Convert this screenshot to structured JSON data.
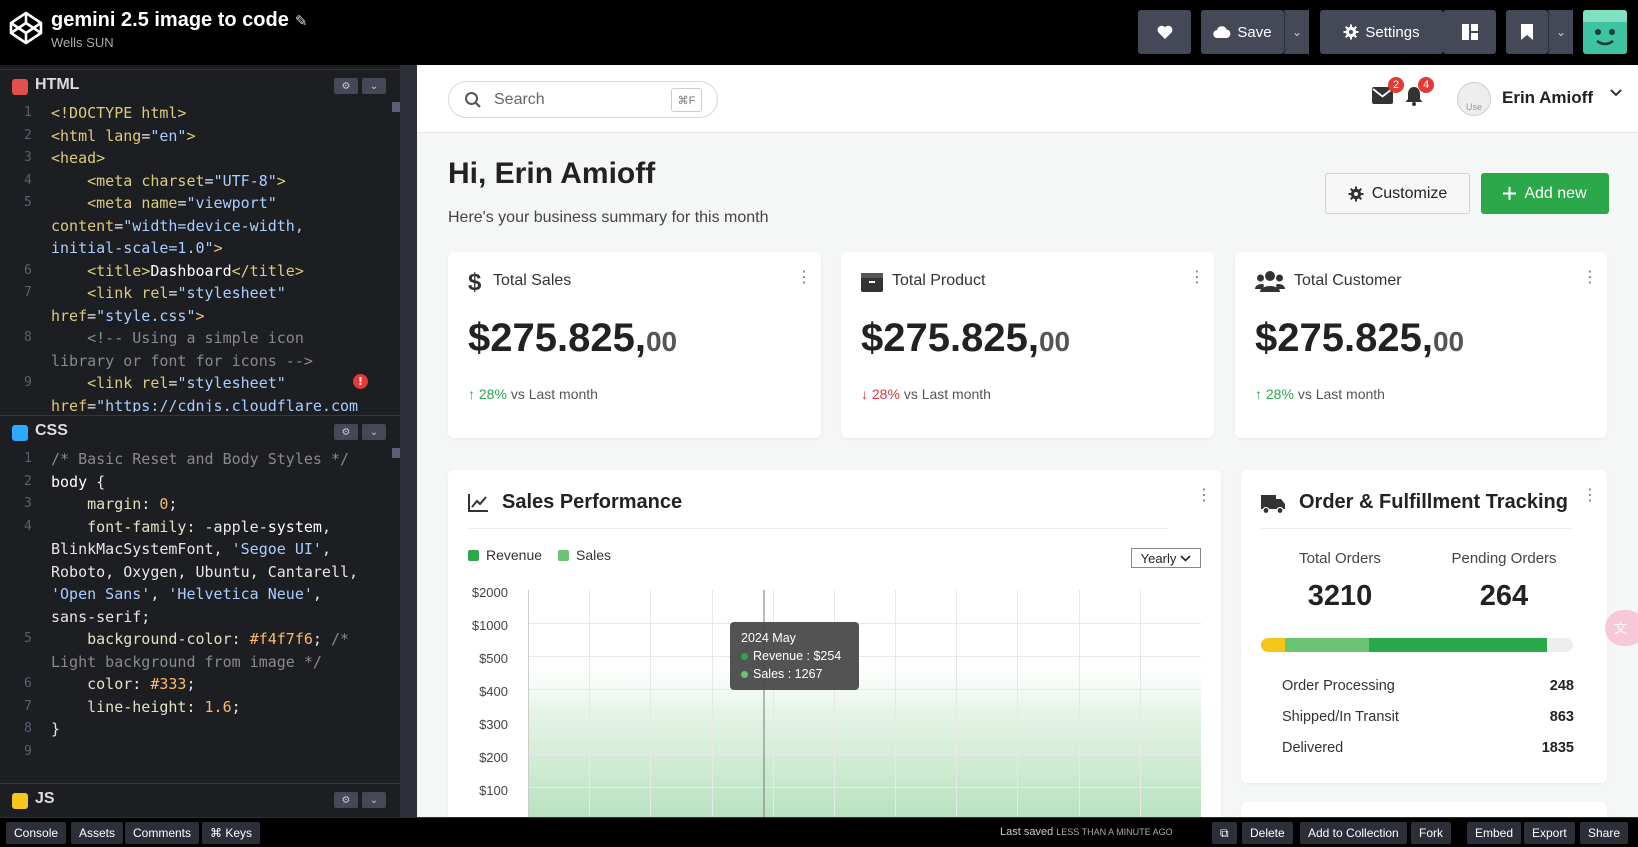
{
  "topbar": {
    "title": "gemini 2.5 image to code",
    "author": "Wells SUN",
    "save_label": "Save",
    "settings_label": "Settings"
  },
  "editors": {
    "html": {
      "label": "HTML",
      "gutter": [
        "1",
        "2",
        "3",
        "4",
        "5",
        "",
        "",
        "6",
        "7",
        "",
        "8",
        "",
        "9",
        ""
      ]
    },
    "css": {
      "label": "CSS",
      "gutter": [
        "1",
        "2",
        "3",
        "4",
        "",
        "",
        "",
        "",
        "5",
        "",
        "6",
        "7",
        "8",
        "9"
      ]
    },
    "js": {
      "label": "JS"
    }
  },
  "preview": {
    "search": {
      "placeholder": "Search",
      "shortcut": "⌘F"
    },
    "mail_count": "2",
    "bell_count": "4",
    "avatar_alt": "Use",
    "user_name": "Erin Amioff",
    "greeting": "Hi, Erin Amioff",
    "subtitle": "Here's your business summary for this month",
    "customize_label": "Customize",
    "add_new_label": "Add new",
    "stats": [
      {
        "title": "Total Sales",
        "value": "$275.825,",
        "cents": "00",
        "trend_pct": "28%",
        "trend_dir": "up",
        "trend_label": "vs Last month"
      },
      {
        "title": "Total Product",
        "value": "$275.825,",
        "cents": "00",
        "trend_pct": "28%",
        "trend_dir": "down",
        "trend_label": "vs Last month"
      },
      {
        "title": "Total Customer",
        "value": "$275.825,",
        "cents": "00",
        "trend_pct": "28%",
        "trend_dir": "up",
        "trend_label": "vs Last month"
      }
    ],
    "performance": {
      "title": "Sales Performance",
      "legend": [
        "Revenue",
        "Sales"
      ],
      "period": "Yearly",
      "y_ticks": [
        "$2000",
        "$1000",
        "$500",
        "$400",
        "$300",
        "$200",
        "$100"
      ],
      "tooltip": {
        "title": "2024 May",
        "revenue": "Revenue : $254",
        "sales": "Sales : 1267"
      }
    },
    "orders": {
      "title": "Order & Fulfillment Tracking",
      "total_label": "Total Orders",
      "total_value": "3210",
      "pending_label": "Pending Orders",
      "pending_value": "264",
      "rows": [
        {
          "label": "Order Processing",
          "value": "248"
        },
        {
          "label": "Shipped/In Transit",
          "value": "863"
        },
        {
          "label": "Delivered",
          "value": "1835"
        }
      ]
    }
  },
  "chart_data": {
    "type": "area",
    "title": "Sales Performance",
    "series": [
      {
        "name": "Revenue"
      },
      {
        "name": "Sales"
      }
    ],
    "y_ticks": [
      "$100",
      "$200",
      "$300",
      "$400",
      "$500",
      "$1000",
      "$2000"
    ],
    "tooltip": {
      "x": "2024 May",
      "Revenue": 254,
      "Sales": 1267
    },
    "legend": "top-left",
    "grid": true
  },
  "bottombar": {
    "console": "Console",
    "assets": "Assets",
    "comments": "Comments",
    "keys": "⌘ Keys",
    "saved_prefix": "Last saved",
    "saved_time": "LESS THAN A MINUTE AGO",
    "delete": "Delete",
    "add_collection": "Add to Collection",
    "fork": "Fork",
    "embed": "Embed",
    "export": "Export",
    "share": "Share"
  },
  "colors": {
    "accent_green": "#2ba84a",
    "light_green": "#6ac472",
    "warning_yellow": "#f5c518",
    "down_red": "#d9363e",
    "badge_red": "#e53935"
  }
}
